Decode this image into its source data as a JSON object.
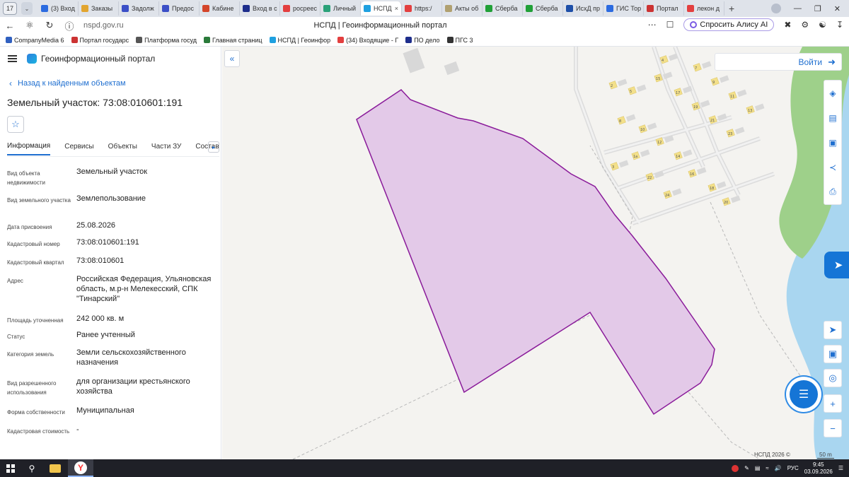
{
  "browser": {
    "tab_count": "17",
    "tabs": [
      {
        "label": "(3) Вход",
        "color": "#2c6be0"
      },
      {
        "label": "Заказы",
        "color": "#e2a530"
      },
      {
        "label": "Задолж",
        "color": "#3b4fc7"
      },
      {
        "label": "Предос",
        "color": "#3b4fc7"
      },
      {
        "label": "Кабине",
        "color": "#d4452a"
      },
      {
        "label": "Вход в с",
        "color": "#1e2e8c"
      },
      {
        "label": "росреес",
        "color": "#e33f3f"
      },
      {
        "label": "Личный",
        "color": "#2aa179"
      },
      {
        "label": "НСПД",
        "color": "#1fa0e0",
        "active": true
      },
      {
        "label": "https:/",
        "color": "#e33f3f"
      },
      {
        "label": "Акты об",
        "color": "#b0a070"
      },
      {
        "label": "Сберба",
        "color": "#21a038"
      },
      {
        "label": "Сберба",
        "color": "#21a038"
      },
      {
        "label": "ИсхД пр",
        "color": "#1e4fa8"
      },
      {
        "label": "ГИС Тор",
        "color": "#2c6be0"
      },
      {
        "label": "Портал",
        "color": "#c33"
      },
      {
        "label": "лекон д",
        "color": "#e33f3f"
      }
    ],
    "active_tab_close": "×",
    "new_tab": "+",
    "url": "nspd.gov.ru",
    "page_title": "НСПД | Геоинформационный портал",
    "alice_button": "Спросить Алису AI",
    "bookmarks": [
      {
        "label": "CompanyMedia 6",
        "color": "#3060c0"
      },
      {
        "label": "Портал государс",
        "color": "#c33"
      },
      {
        "label": "Платформа госуд",
        "color": "#555"
      },
      {
        "label": "Главная страниц",
        "color": "#2a7a3a"
      },
      {
        "label": "НСПД | Геоинфор",
        "color": "#1fa0e0"
      },
      {
        "label": "(34) Входящие - Г",
        "color": "#e33f3f"
      },
      {
        "label": "ПО дело",
        "color": "#1e2e8c"
      },
      {
        "label": "ПГС 3",
        "color": "#333"
      }
    ]
  },
  "panel": {
    "portal_name": "Геоинформационный портал",
    "back_link": "Назад к найденным объектам",
    "object_title": "Земельный участок: 73:08:010601:191",
    "tabs": [
      "Информация",
      "Сервисы",
      "Объекты",
      "Части ЗУ",
      "Состав"
    ],
    "properties": [
      {
        "label": "Вид объекта недвижимости",
        "value": "Земельный участок"
      },
      {
        "label": "Вид земельного участка",
        "value": "Землепользование"
      },
      {
        "label": "Дата присвоения",
        "value": "25.08.2026"
      },
      {
        "label": "Кадастровый номер",
        "value": "73:08:010601:191"
      },
      {
        "label": "Кадастровый квартал",
        "value": "73:08:010601"
      },
      {
        "label": "Адрес",
        "value": "Российская Федерация, Ульяновская область, м.р-н Мелекесский, СПК \"Тинарский\""
      },
      {
        "label": "Площадь уточненная",
        "value": "242 000 кв. м"
      },
      {
        "label": "Статус",
        "value": "Ранее учтенный"
      },
      {
        "label": "Категория земель",
        "value": "Земли сельскохозяйственного назначения"
      },
      {
        "label": "Вид разрешенного использования",
        "value": "для организации крестьянского хозяйства"
      },
      {
        "label": "Форма собственности",
        "value": "Муниципальная"
      },
      {
        "label": "Кадастровая стоимость",
        "value": "-"
      }
    ]
  },
  "map": {
    "login": "Войти",
    "parcel_fill": "#e3c9e8",
    "parcel_stroke": "#8a1b9a",
    "water_color": "#a9d6f0",
    "green_color": "#9ed08a",
    "attribution": "НСПД 2026 ©",
    "scale": "50 m",
    "house_labels": [
      "4",
      "7",
      "9",
      "11",
      "13",
      "15",
      "17",
      "19",
      "21",
      "23",
      "2",
      "5",
      "8",
      "10",
      "12",
      "14",
      "16",
      "18",
      "20",
      "22",
      "24",
      "1а",
      "3"
    ]
  },
  "taskbar": {
    "lang": "РУС",
    "time": "9:45",
    "date": "03.09.2026"
  }
}
